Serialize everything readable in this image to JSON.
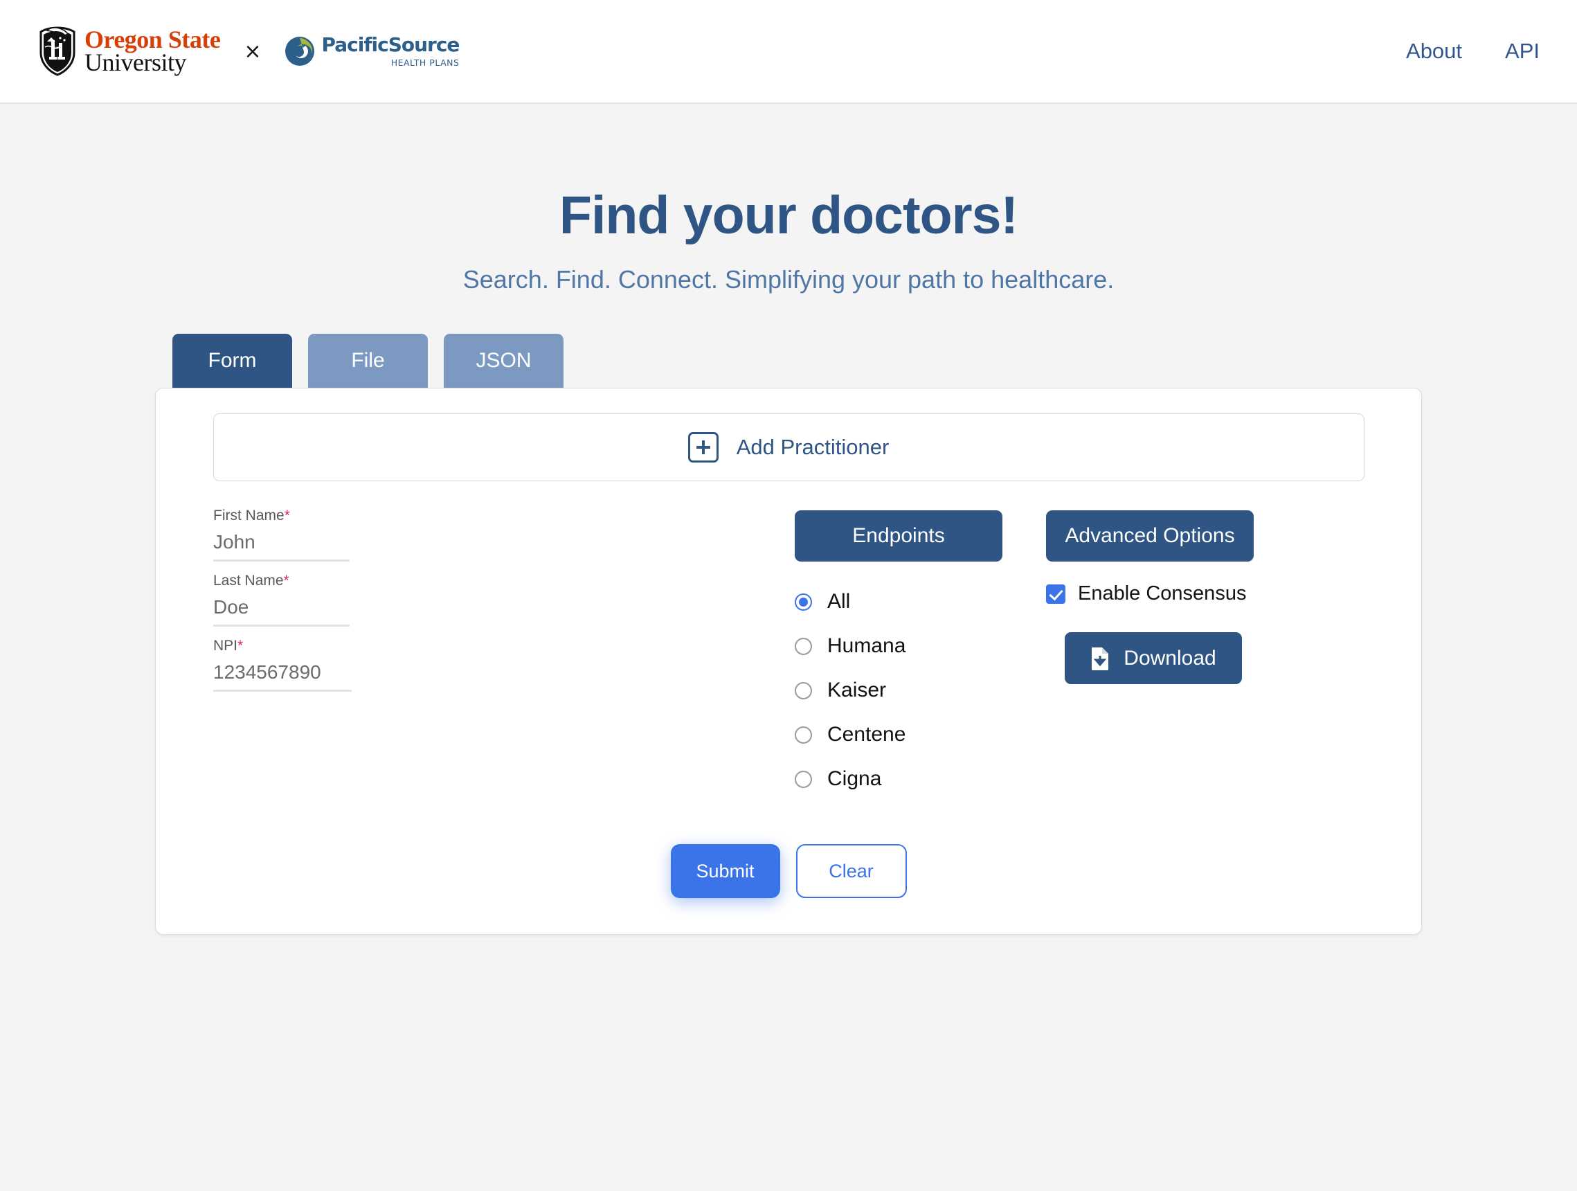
{
  "header": {
    "osu": {
      "line1": "Oregon State",
      "line2": "University",
      "seal_icon": "osu-beaver-seal-icon"
    },
    "separator": "×",
    "pacificsource": {
      "name": "PacificSource",
      "subtitle": "HEALTH PLANS",
      "swirl_icon": "pacificsource-swirl-icon"
    },
    "nav": [
      {
        "label": "About",
        "name": "nav-link-about"
      },
      {
        "label": "API",
        "name": "nav-link-api"
      }
    ]
  },
  "hero": {
    "title": "Find your doctors!",
    "subtitle": "Search. Find. Connect. Simplifying your path to healthcare."
  },
  "tabs": [
    {
      "label": "Form",
      "active": true
    },
    {
      "label": "File",
      "active": false
    },
    {
      "label": "JSON",
      "active": false
    }
  ],
  "form": {
    "add_practitioner": {
      "label": "Add Practitioner",
      "icon": "plus-square-icon"
    },
    "fields": [
      {
        "label": "First Name",
        "required": "*",
        "value": "John"
      },
      {
        "label": "Last Name",
        "required": "*",
        "value": "Doe"
      },
      {
        "label": "NPI",
        "required": "*",
        "value": "1234567890"
      }
    ],
    "endpoints": {
      "button_label": "Endpoints",
      "options": [
        {
          "label": "All",
          "selected": true
        },
        {
          "label": "Humana",
          "selected": false
        },
        {
          "label": "Kaiser",
          "selected": false
        },
        {
          "label": "Centene",
          "selected": false
        },
        {
          "label": "Cigna",
          "selected": false
        }
      ]
    },
    "advanced": {
      "button_label": "Advanced Options",
      "consensus": {
        "label": "Enable Consensus",
        "checked": true
      },
      "download": {
        "label": "Download",
        "icon": "file-download-icon"
      }
    },
    "actions": {
      "submit_label": "Submit",
      "clear_label": "Clear"
    }
  },
  "colors": {
    "brand_navy": "#2f5584",
    "brand_orange": "#d73f09",
    "accent_blue": "#3b74e8",
    "tab_inactive": "#7c9ac1",
    "required_red": "#e0245e",
    "page_bg": "#f4f4f4"
  }
}
